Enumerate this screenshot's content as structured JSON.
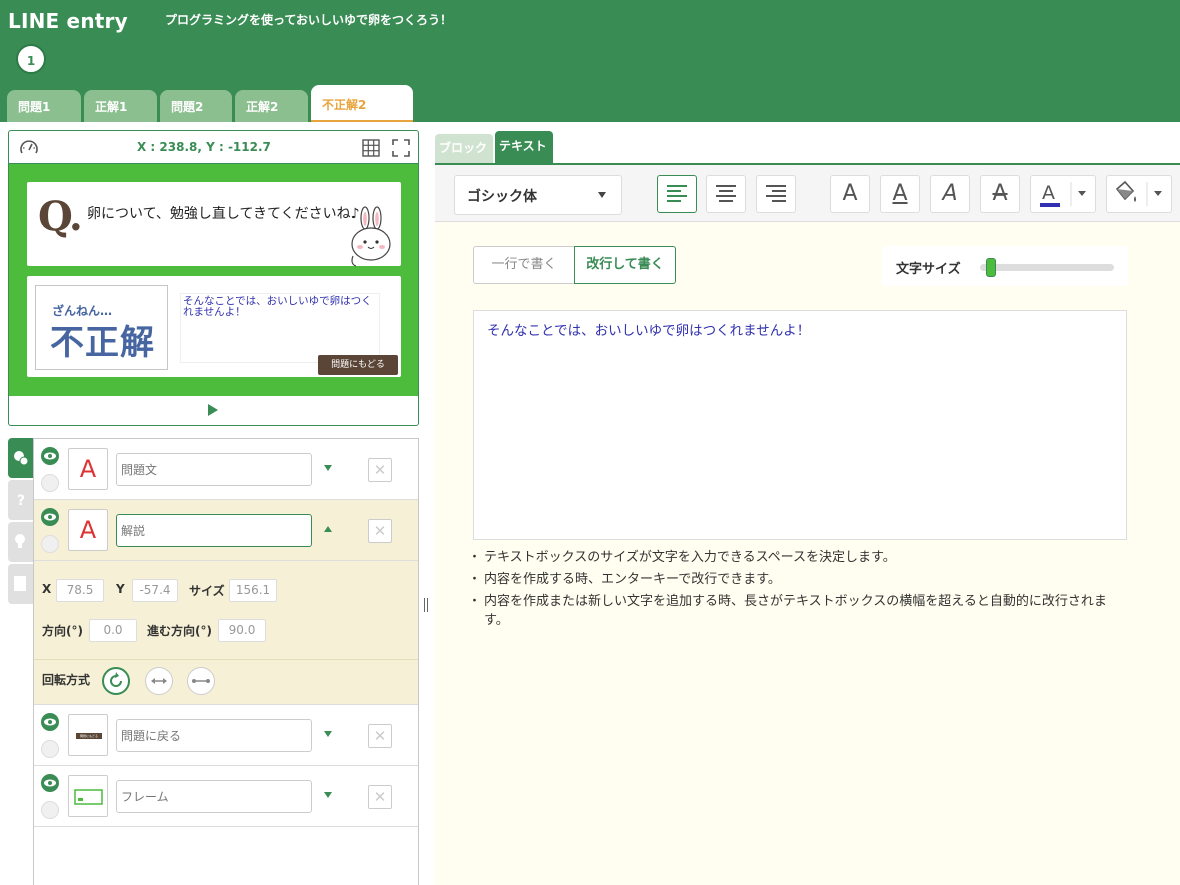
{
  "header": {
    "logo": "LINE entry",
    "title": "プログラミングを使っておいしいゆで卵をつくろう！",
    "step": "1"
  },
  "tabs": [
    {
      "label": "問題1"
    },
    {
      "label": "正解1"
    },
    {
      "label": "問題2"
    },
    {
      "label": "正解2"
    },
    {
      "label": "不正解2"
    }
  ],
  "stage": {
    "coords": "X : 238.8, Y : -112.7",
    "q_letter": "Q.",
    "question": "卵について、勉強し直してきてくださいね♪",
    "result_small": "ざんねん…",
    "result_big": "不正解",
    "explanation": "そんなことでは、おいしいゆで卵はつくれませんよ！",
    "back_button": "問題にもどる"
  },
  "objects": [
    {
      "name_placeholder": "問題文",
      "thumb": "A"
    },
    {
      "name_placeholder": "解説",
      "thumb": "A"
    },
    {
      "name_placeholder": "問題に戻る",
      "thumb_label": "問題にもどる"
    },
    {
      "name_placeholder": "フレーム"
    }
  ],
  "props": {
    "x_label": "X",
    "x_value": "78.5",
    "y_label": "Y",
    "y_value": "-57.4",
    "size_label": "サイズ",
    "size_value": "156.1",
    "dir_label": "方向(°)",
    "dir_value": "0.0",
    "move_dir_label": "進む方向(°)",
    "move_dir_value": "90.0",
    "rotation_label": "回転方式"
  },
  "right_tabs": {
    "block": "ブロック",
    "text": "テキスト"
  },
  "toolbar": {
    "font": "ゴシック体"
  },
  "editor": {
    "mode_single": "一行で書く",
    "mode_multi": "改行して書く",
    "font_size_label": "文字サイズ",
    "font_size_level": 0.05,
    "text": "そんなことでは、おいしいゆで卵はつくれませんよ！",
    "notes": [
      "テキストボックスのサイズが文字を入力できるスペースを決定します。",
      "内容を作成する時、エンターキーで改行できます。",
      "内容を作成または新しい文字を追加する時、長さがテキストボックスの横幅を超えると自動的に改行されます。"
    ]
  },
  "colors": {
    "brand": "#3a8c55",
    "accent": "#e8a43d",
    "stage_green": "#4dbc3d",
    "text_blue": "#3030b0"
  }
}
